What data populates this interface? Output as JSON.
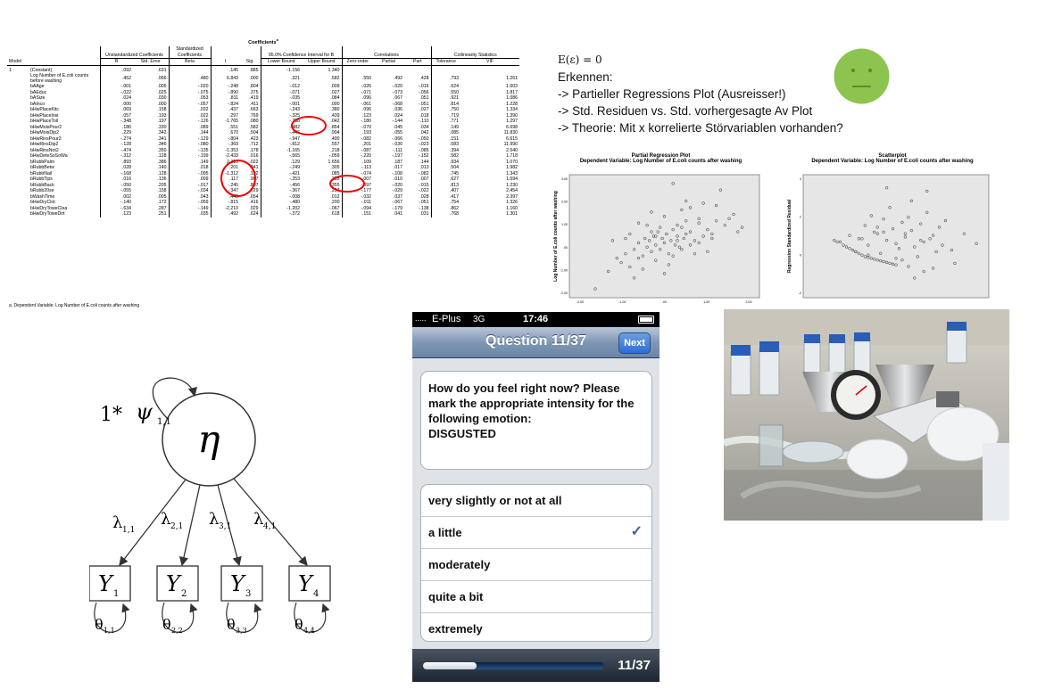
{
  "coefficients": {
    "title": "Coefficients",
    "title_sup": "a",
    "groups": {
      "unstd": "Unstandardized Coefficients",
      "std": "Standardized Coefficients",
      "ci": "95.0% Confidence Interval for B",
      "corr": "Correlations",
      "coll": "Collinearity Statistics"
    },
    "headers": [
      "Model",
      "",
      "B",
      "Std. Error",
      "Beta",
      "t",
      "Sig.",
      "Lower Bound",
      "Upper Bound",
      "Zero-order",
      "Partial",
      "Part",
      "Tolerance",
      "VIF"
    ],
    "rows": [
      [
        "1",
        "(Constant)",
        ".092",
        ".631",
        "",
        ".145",
        ".885",
        "-1.156",
        "1.340",
        "",
        "",
        "",
        "",
        ""
      ],
      [
        "",
        "Log Number of E.coli counts before washing",
        ".452",
        ".066",
        ".480",
        "6.843",
        ".000",
        ".321",
        ".582",
        ".550",
        ".492",
        ".428",
        ".793",
        "1.261"
      ],
      [
        "",
        "bAAge",
        "-.001",
        ".005",
        "-.020",
        "-.248",
        ".804",
        "-.012",
        ".009",
        "-.026",
        "-.020",
        "-.016",
        ".624",
        "1.603"
      ],
      [
        "",
        "bAEduc",
        "-.022",
        ".025",
        "-.075",
        "-.890",
        ".375",
        "-.071",
        ".027",
        "-.071",
        "-.073",
        "-.056",
        ".550",
        "1.817"
      ],
      [
        "",
        "bASize",
        ".024",
        ".030",
        ".053",
        ".811",
        ".419",
        "-.035",
        ".084",
        ".096",
        ".067",
        ".051",
        ".921",
        "1.086"
      ],
      [
        "",
        "bAInco",
        ".000",
        ".000",
        "-.057",
        "-.824",
        ".411",
        "-.001",
        ".000",
        "-.061",
        "-.068",
        "-.051",
        ".814",
        "1.228"
      ],
      [
        "",
        "bHwPlaceKitc",
        ".069",
        ".158",
        ".032",
        ".437",
        ".663",
        "-.243",
        ".380",
        ".096",
        ".036",
        ".027",
        ".750",
        "1.334"
      ],
      [
        "",
        "bHwPlaceInsi",
        ".057",
        ".193",
        ".022",
        ".297",
        ".769",
        "-.325",
        ".439",
        ".123",
        ".024",
        ".018",
        ".719",
        "1.390"
      ],
      [
        "",
        "bHwPlaceToil",
        "-.348",
        ".197",
        "-.126",
        "-1.765",
        ".080",
        "-.738",
        ".042",
        "-.180",
        "-.144",
        "-.110",
        ".771",
        "1.297"
      ],
      [
        "",
        "bHwMoisPour2",
        ".186",
        ".330",
        ".089",
        ".551",
        ".582",
        "-.482",
        ".854",
        "-.070",
        ".045",
        ".034",
        ".149",
        "6.698"
      ],
      [
        "",
        "bHwMoisDip2",
        ".229",
        ".342",
        ".144",
        ".670",
        ".504",
        "-.446",
        ".904",
        ".193",
        ".055",
        ".042",
        ".085",
        "11.830"
      ],
      [
        "",
        "bHwRinsPour2",
        "-.274",
        ".341",
        "-.129",
        "-.804",
        ".423",
        "-.947",
        ".400",
        "-.082",
        "-.066",
        "-.050",
        ".151",
        "6.615"
      ],
      [
        "",
        "bHwRinsDip2",
        "-.128",
        ".346",
        "-.080",
        "-.369",
        ".712",
        "-.812",
        ".557",
        ".201",
        "-.030",
        "-.023",
        ".083",
        "11.990"
      ],
      [
        "",
        "bHwRinsNot2",
        "-.474",
        ".350",
        "-.135",
        "-1.353",
        ".178",
        "-1.165",
        ".218",
        "-.087",
        "-.111",
        "-.085",
        ".394",
        "2.540"
      ],
      [
        "",
        "bHwDeteSoSoWa",
        "-.312",
        ".128",
        "-.199",
        "-2.433",
        ".016",
        "-.565",
        "-.059",
        "-.220",
        "-.197",
        "-.152",
        ".582",
        "1.718"
      ],
      [
        "",
        "bRubbPalm",
        ".893",
        ".386",
        ".149",
        "2.310",
        ".022",
        ".129",
        "1.656",
        ".109",
        ".187",
        ".144",
        ".934",
        "1.070"
      ],
      [
        "",
        "bRubbBetw",
        ".028",
        ".140",
        ".018",
        ".201",
        ".841",
        "-.249",
        ".305",
        "-.113",
        ".017",
        ".013",
        ".504",
        "1.982"
      ],
      [
        "",
        "bRubbNail",
        "-.168",
        ".128",
        "-.095",
        "-1.312",
        ".192",
        "-.421",
        ".085",
        "-.074",
        "-.108",
        "-.082",
        ".745",
        "1.343"
      ],
      [
        "",
        "bRubbTips",
        ".016",
        ".136",
        ".009",
        ".117",
        ".907",
        "-.253",
        ".285",
        "-.007",
        ".010",
        ".007",
        ".627",
        "1.594"
      ],
      [
        "",
        "bRubbBack",
        "-.050",
        ".205",
        "-.017",
        "-.245",
        ".807",
        "-.456",
        ".355",
        "-.097",
        "-.020",
        "-.015",
        ".813",
        "1.230"
      ],
      [
        "",
        "bRubb20se",
        "-.055",
        ".158",
        "-.034",
        "-.347",
        ".729",
        "-.367",
        ".257",
        "-.177",
        "-.029",
        "-.022",
        ".407",
        "2.454"
      ],
      [
        "",
        "bWashTime",
        ".002",
        ".005",
        ".043",
        ".449",
        ".654",
        "-.008",
        ".012",
        "-.032",
        ".037",
        ".028",
        ".417",
        "2.397"
      ],
      [
        "",
        "bHwDryClot",
        "-.140",
        ".172",
        "-.059",
        "-.815",
        ".416",
        "-.480",
        ".200",
        "-.011",
        "-.067",
        "-.051",
        ".754",
        "1.326"
      ],
      [
        "",
        "bHwDryToweClea",
        "-.634",
        ".287",
        "-.149",
        "-2.210",
        ".029",
        "-1.202",
        "-.067",
        "-.094",
        "-.179",
        "-.138",
        ".862",
        "1.160"
      ],
      [
        "",
        "bHwDryToweDirt",
        ".123",
        ".251",
        ".035",
        ".492",
        ".624",
        "-.372",
        ".618",
        ".151",
        ".041",
        ".031",
        ".768",
        "1.301"
      ]
    ],
    "footnote": "a. Dependent Variable: Log Number of E.coli counts after washing"
  },
  "notes": {
    "formula": "E(ε) = 0",
    "lines": [
      "Erkennen:",
      "-> Partieller Regressions Plot (Ausreisser!)",
      "-> Std. Residuen vs. Std. vorhergesagte Av Plot",
      "-> Theorie: Mit x korrelierte Störvariablen vorhanden?"
    ],
    "smiley_color": "#8dc44f"
  },
  "chart_data": [
    {
      "type": "scatter",
      "title": "Partial Regression Plot",
      "subtitle": "Dependent Variable: Log Number of E.coli counts after washing",
      "ylabel": "Log Number of E.coli counts after washing",
      "xlabel": "",
      "x_ticks": [
        "-2.00",
        "-1.00",
        ".00",
        "1.00",
        "2.00"
      ],
      "y_ticks": [
        "3.00",
        "2.00",
        "1.00",
        ".00",
        "-1.00",
        "-2.00"
      ],
      "xlim": [
        -2.2,
        2.2
      ],
      "ylim": [
        -2.4,
        3.2
      ],
      "x": [
        -1.6,
        -1.3,
        -1.1,
        -0.9,
        -0.8,
        -0.7,
        -0.6,
        -0.5,
        -0.45,
        -0.4,
        -0.35,
        -0.3,
        -0.25,
        -0.2,
        -0.15,
        -0.1,
        -0.05,
        0.0,
        0.05,
        0.1,
        0.15,
        0.2,
        0.25,
        0.3,
        0.35,
        0.4,
        0.45,
        0.5,
        0.6,
        0.7,
        0.8,
        0.9,
        1.0,
        1.1,
        1.2,
        1.4,
        1.6,
        1.8,
        -1.0,
        -0.8,
        -0.6,
        -0.4,
        -0.2,
        0.0,
        0.2,
        0.4,
        0.6,
        0.8,
        1.0,
        1.2,
        -0.7,
        -0.3,
        0.1,
        0.5,
        0.9,
        1.3,
        -1.2,
        -0.5,
        0.3,
        0.7,
        1.5,
        -0.9,
        -0.1,
        0.8,
        0.2,
        -0.3,
        0.4,
        0.6,
        0.0,
        -0.6,
        1.1,
        0.3,
        -0.2,
        0.5,
        1.7
      ],
      "y": [
        -2.0,
        -1.2,
        -0.6,
        -0.4,
        -1.0,
        -0.2,
        0.1,
        -0.5,
        0.3,
        -0.1,
        0.2,
        -0.3,
        0.4,
        0.0,
        0.6,
        -0.2,
        0.3,
        0.1,
        0.5,
        -0.4,
        0.2,
        0.7,
        0.0,
        0.4,
        -0.1,
        0.8,
        0.3,
        0.5,
        0.6,
        0.2,
        1.0,
        0.4,
        0.7,
        0.3,
        1.1,
        0.9,
        1.4,
        0.8,
        -0.8,
        0.5,
        -0.6,
        0.9,
        -0.7,
        1.3,
        -0.5,
        1.6,
        0.0,
        1.2,
        -0.3,
        1.8,
        -1.5,
        1.5,
        -0.9,
        2.0,
        1.9,
        2.5,
        0.2,
        -1.1,
        0.9,
        -0.4,
        1.2,
        0.3,
        0.8,
        0.1,
        2.8,
        0.6,
        -0.2,
        1.7,
        -1.3,
        1.0,
        0.5,
        0.2,
        0.4,
        1.1,
        0.6
      ]
    },
    {
      "type": "scatter",
      "title": "Scatterplot",
      "subtitle": "Dependent Variable: Log Number of E.coli counts after washing",
      "ylabel": "Regression Standardized Residual",
      "xlabel": "",
      "y_ticks": [
        "4",
        "2",
        "0",
        "-2"
      ],
      "xlim": [
        -3,
        3
      ],
      "ylim": [
        -3,
        4.5
      ],
      "x": [
        -2.0,
        -1.9,
        -1.7,
        -1.6,
        -1.5,
        -1.4,
        -1.3,
        -1.2,
        -1.1,
        -1.0,
        -0.9,
        -0.8,
        -0.7,
        -0.6,
        -0.5,
        -0.4,
        -0.3,
        -0.2,
        -0.1,
        0.0,
        -1.8,
        -1.5,
        -1.2,
        -0.9,
        -0.6,
        -0.3,
        0.0,
        0.3,
        0.6,
        0.9,
        1.2,
        1.5,
        1.8,
        -1.0,
        -0.7,
        -0.4,
        -0.1,
        0.2,
        0.5,
        0.8,
        1.1,
        1.4,
        -1.3,
        -0.8,
        -0.2,
        0.4,
        1.0,
        1.6,
        2.2,
        -0.5,
        0.1,
        0.7,
        1.3,
        -1.1,
        -0.3,
        0.5,
        0.9,
        0.0,
        0.6,
        1.2,
        -0.6,
        0.2,
        0.8,
        2.6,
        1.9,
        -0.9,
        0.3,
        1.0,
        -0.4,
        0.4
      ],
      "y": [
        0.5,
        0.4,
        0.2,
        0.1,
        0.0,
        -0.1,
        -0.2,
        -0.3,
        -0.4,
        -0.5,
        -0.55,
        -0.6,
        -0.65,
        -0.7,
        -0.75,
        -0.8,
        -0.85,
        -0.9,
        -0.95,
        -1.0,
        0.4,
        0.8,
        0.6,
        0.2,
        0.9,
        0.5,
        0.3,
        0.7,
        0.1,
        0.4,
        0.8,
        0.2,
        -0.1,
        1.4,
        1.0,
        1.8,
        1.2,
        1.6,
        1.1,
        1.5,
        0.6,
        1.3,
        -0.2,
        2.0,
        2.5,
        1.9,
        2.2,
        1.7,
        0.9,
        -0.3,
        0.0,
        -0.5,
        -0.2,
        0.6,
        3.7,
        2.9,
        -1.4,
        -0.6,
        -1.8,
        -1.2,
        1.3,
        -0.7,
        0.5,
        0.3,
        -0.9,
        -0.4,
        0.9,
        3.5,
        1.0,
        -1.1
      ]
    }
  ],
  "diagram": {
    "latent": "η",
    "variance_prefix": "1*",
    "variance": "ψ",
    "variance_sub": "1,1",
    "loadings": [
      {
        "sym": "λ",
        "sub": "1,1"
      },
      {
        "sym": "λ",
        "sub": "2,1"
      },
      {
        "sym": "λ",
        "sub": "3,1"
      },
      {
        "sym": "λ",
        "sub": "4,1"
      }
    ],
    "indicators": [
      {
        "sym": "Y",
        "sub": "1"
      },
      {
        "sym": "Y",
        "sub": "2"
      },
      {
        "sym": "Y",
        "sub": "3"
      },
      {
        "sym": "Y",
        "sub": "4"
      }
    ],
    "errors": [
      {
        "sym": "θ",
        "sub": "1,1"
      },
      {
        "sym": "θ",
        "sub": "2,2"
      },
      {
        "sym": "θ",
        "sub": "3,3"
      },
      {
        "sym": "θ",
        "sub": "4,4"
      }
    ]
  },
  "phone": {
    "signal": ".....",
    "carrier": "E-Plus",
    "network": "3G",
    "time": "17:46",
    "title": "Question 11/37",
    "next_label": "Next",
    "question": "How do you feel right now? Please mark the appropriate intensity for the following emotion:",
    "emotion": "DISGUSTED",
    "options": [
      {
        "label": "very slightly or not at all",
        "checked": false
      },
      {
        "label": "a little",
        "checked": true
      },
      {
        "label": "moderately",
        "checked": false
      },
      {
        "label": "quite a bit",
        "checked": false
      },
      {
        "label": "extremely",
        "checked": false
      }
    ],
    "checkmark": "✓",
    "progress_fraction": 0.297,
    "progress_label": "11/37"
  }
}
